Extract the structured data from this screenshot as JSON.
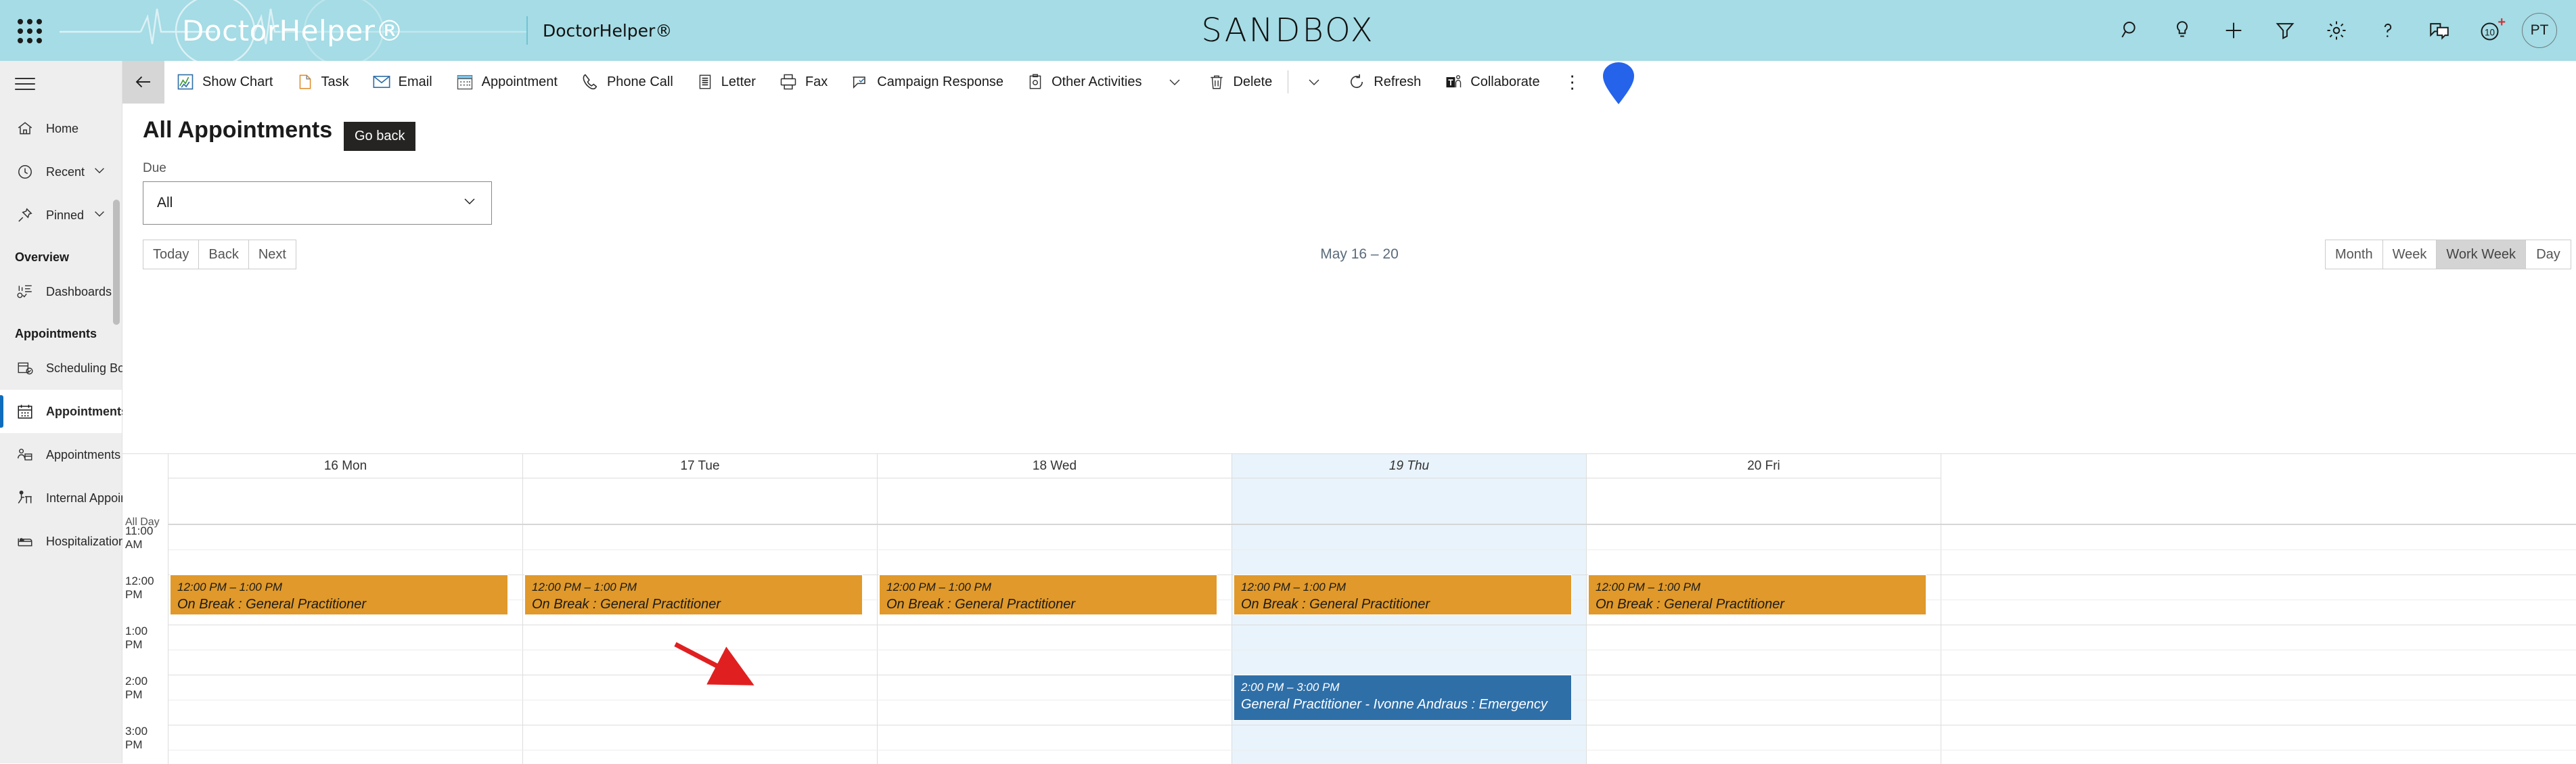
{
  "header": {
    "waffle_icon": "app-launcher-icon",
    "logo_text": "DoctorHelper®",
    "app_name": "DoctorHelper®",
    "environment_label": "SANDBOX",
    "icons": [
      {
        "name": "search-icon",
        "label": "Search"
      },
      {
        "name": "lightbulb-icon",
        "label": "Insights"
      },
      {
        "name": "plus-icon",
        "label": "New"
      },
      {
        "name": "filter-icon",
        "label": "Filter"
      },
      {
        "name": "gear-icon",
        "label": "Settings"
      },
      {
        "name": "help-icon",
        "label": "Help"
      },
      {
        "name": "feedback-icon",
        "label": "Feedback"
      },
      {
        "name": "assistant-icon",
        "label": "Assistant"
      }
    ],
    "notification_badge": "+",
    "avatar_initials": "PT"
  },
  "sidebar": {
    "hamburger": "menu-icon",
    "items": [
      {
        "label": "Home",
        "icon": "home-icon",
        "chevron": false,
        "selected": false
      },
      {
        "label": "Recent",
        "icon": "clock-icon",
        "chevron": true,
        "selected": false
      },
      {
        "label": "Pinned",
        "icon": "pin-icon",
        "chevron": true,
        "selected": false
      }
    ],
    "groups": [
      {
        "title": "Overview",
        "items": [
          {
            "label": "Dashboards",
            "icon": "dashboard-icon",
            "selected": false
          }
        ]
      },
      {
        "title": "Appointments",
        "items": [
          {
            "label": "Scheduling Board",
            "icon": "scheduling-board-icon",
            "selected": false
          },
          {
            "label": "Appointments Bo...",
            "icon": "calendar-icon",
            "selected": true
          },
          {
            "label": "Appointments",
            "icon": "person-calendar-icon",
            "selected": false
          },
          {
            "label": "Internal Appoint...",
            "icon": "internal-appointment-icon",
            "selected": false
          },
          {
            "label": "Hospitalizations",
            "icon": "bed-icon",
            "selected": false
          }
        ]
      }
    ]
  },
  "commandbar": {
    "back_icon": "arrow-left-icon",
    "tooltip": "Go back",
    "commands": [
      {
        "label": "Show Chart",
        "icon": "chart-icon"
      },
      {
        "label": "Task",
        "icon": "task-icon"
      },
      {
        "label": "Email",
        "icon": "email-icon"
      },
      {
        "label": "Appointment",
        "icon": "appointment-icon"
      },
      {
        "label": "Phone Call",
        "icon": "phone-icon"
      },
      {
        "label": "Letter",
        "icon": "letter-icon"
      },
      {
        "label": "Fax",
        "icon": "fax-icon"
      },
      {
        "label": "Campaign Response",
        "icon": "campaign-response-icon"
      },
      {
        "label": "Other Activities",
        "icon": "other-activities-icon",
        "caret": true
      },
      {
        "label": "Delete",
        "icon": "delete-icon"
      },
      {
        "label": "Refresh",
        "icon": "refresh-icon"
      },
      {
        "label": "Collaborate",
        "icon": "collaborate-icon"
      }
    ],
    "overflow_icon": "more-vertical-icon"
  },
  "view": {
    "title": "All Appointments",
    "title_chevron": "chevron-down-icon",
    "due_label": "Due",
    "due_value": "All",
    "due_chevron": "chevron-down-icon",
    "nav_buttons": [
      "Today",
      "Back",
      "Next"
    ],
    "date_range": "May 16 – 20",
    "view_modes": [
      {
        "label": "Month",
        "active": false
      },
      {
        "label": "Week",
        "active": false
      },
      {
        "label": "Work Week",
        "active": true
      },
      {
        "label": "Day",
        "active": false
      }
    ]
  },
  "calendar": {
    "all_day_label": "All Day",
    "hour_labels": [
      "11:00 AM",
      "12:00 PM",
      "1:00 PM",
      "2:00 PM",
      "3:00 PM"
    ],
    "days": [
      {
        "label": "16 Mon",
        "today": false
      },
      {
        "label": "17 Tue",
        "today": false
      },
      {
        "label": "18 Wed",
        "today": false
      },
      {
        "label": "19 Thu",
        "today": true
      },
      {
        "label": "20 Fri",
        "today": false
      }
    ],
    "events": [
      {
        "day": 0,
        "time": "12:00 PM – 1:00 PM",
        "title": "On Break : General Practitioner",
        "color": "orange"
      },
      {
        "day": 1,
        "time": "12:00 PM – 1:00 PM",
        "title": "On Break : General Practitioner",
        "color": "orange"
      },
      {
        "day": 2,
        "time": "12:00 PM – 1:00 PM",
        "title": "On Break : General Practitioner",
        "color": "orange"
      },
      {
        "day": 3,
        "time": "12:00 PM – 1:00 PM",
        "title": "On Break : General Practitioner",
        "color": "orange"
      },
      {
        "day": 4,
        "time": "12:00 PM – 1:00 PM",
        "title": "On Break : General Practitioner",
        "color": "orange"
      },
      {
        "day": 3,
        "time": "2:00 PM – 3:00 PM",
        "title": "General Practitioner - Ivonne Andraus : Emergency",
        "color": "blue"
      }
    ]
  },
  "colors": {
    "header_bg": "#a5dce5",
    "accent": "#0f6cbd",
    "event_orange": "#e0992a",
    "event_blue": "#2f6fa8",
    "today_bg": "#e9f3fb",
    "annotation_red": "#e02020",
    "pointer_blue": "#2563eb"
  }
}
